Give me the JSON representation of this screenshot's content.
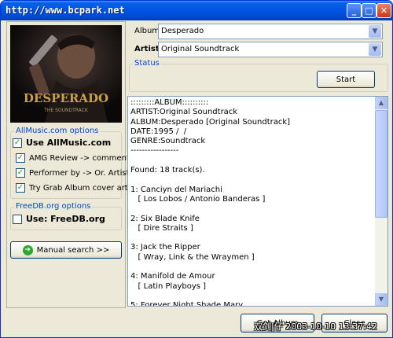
{
  "window": {
    "title": "http://www.bcpark.net",
    "minimize_glyph": "_",
    "maximize_glyph": "□",
    "close_glyph": "✕"
  },
  "cover": {
    "title": "DESPERADO",
    "subtitle": "THE SOUNDTRACK"
  },
  "allmusic": {
    "legend": "AllMusic.com options",
    "use_label": "Use AllMusic.com",
    "use_checked": true,
    "options": [
      {
        "label": "AMG Review -> comment",
        "checked": true
      },
      {
        "label": "Performer by -> Or. Artist",
        "checked": true
      },
      {
        "label": "Try Grab Album cover art",
        "checked": true
      }
    ]
  },
  "freedb": {
    "legend": "FreeDB.org options",
    "use_label": "Use: FreeDB.org",
    "use_checked": false
  },
  "manual_search": {
    "label": "Manual search >>",
    "icon": "go-arrow-icon"
  },
  "form": {
    "album_label": "Album:",
    "album_value": "Desperado",
    "artist_label": "Artist:",
    "artist_value": "Original Soundtrack",
    "status_legend": "Status",
    "start_label": "Start"
  },
  "results": {
    "text": ":::::::::ALBUM::::::::::\nARTIST:Original Soundtrack\nALBUM:Desperado [Original Soundtrack]\nDATE:1995 /  /\nGENRE:Soundtrack\n-----------------\n\nFound: 18 track(s).\n\n1: Canciyn del Mariachi\n   [ Los Lobos / Antonio Banderas ]\n\n2: Six Blade Knife\n   [ Dire Straits ]\n\n3: Jack the Ripper\n   [ Wray, Link & the Wraymen ]\n\n4: Manifold de Amour\n   [ Latin Playboys ]\n\n5: Forever Night Shade Mary"
  },
  "footer": {
    "get_label": "Get Album",
    "close_label": "Close",
    "watermark": "双剑|仔 2003-10-10 13:37:42"
  },
  "colors": {
    "titlebar": "#0054e3",
    "window_bg": "#ece9d8",
    "legend_text": "#0046d5"
  }
}
